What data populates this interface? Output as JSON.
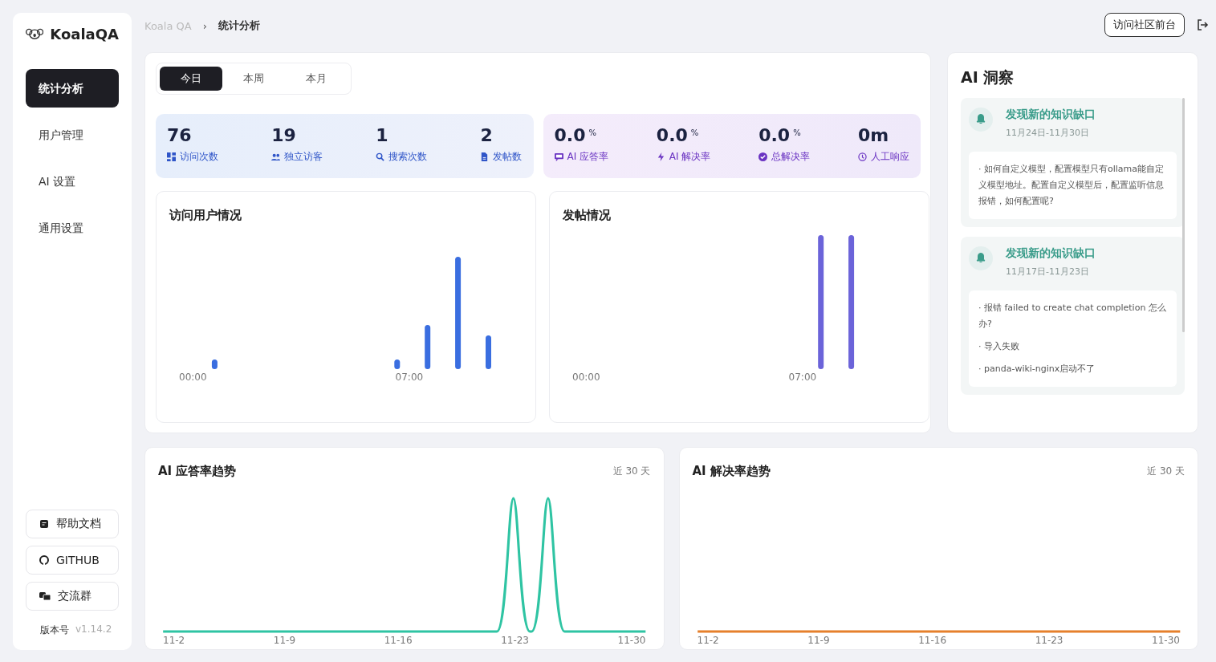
{
  "sidebar": {
    "logo": "KoalaQA",
    "items": [
      {
        "label": "统计分析",
        "selected": true
      },
      {
        "label": "用户管理",
        "selected": false
      },
      {
        "label": "AI 设置",
        "selected": false
      },
      {
        "label": "通用设置",
        "selected": false
      }
    ],
    "links": [
      "帮助文档",
      "GITHUB",
      "交流群"
    ],
    "version_label": "版本号",
    "version": "v1.14.2"
  },
  "breadcrumb": [
    "Koala QA",
    "统计分析"
  ],
  "breadcrumb_separator": "›",
  "top_button": "访问社区前台",
  "tabs": [
    {
      "label": "今日",
      "selected": true
    },
    {
      "label": "本周",
      "selected": false
    },
    {
      "label": "本月",
      "selected": false
    }
  ],
  "stat_groups": [
    {
      "kind": "traffic",
      "stats": [
        {
          "value": "76",
          "label": "访问次数"
        },
        {
          "value": "19",
          "label": "独立访客"
        },
        {
          "value": "1",
          "label": "搜索次数"
        },
        {
          "value": "2",
          "label": "发帖数"
        }
      ]
    },
    {
      "kind": "ai",
      "stats": [
        {
          "value": "0.0",
          "unit": "%",
          "label": "AI 应答率"
        },
        {
          "value": "0.0",
          "unit": "%",
          "label": "AI 解决率"
        },
        {
          "value": "0.0",
          "unit": "%",
          "label": "总解决率"
        },
        {
          "value": "0m",
          "label": "人工响应"
        }
      ]
    }
  ],
  "hour_charts": [
    {
      "title": "访问用户情况",
      "x_labels": [
        "00:00",
        "07:00"
      ]
    },
    {
      "title": "发帖情况",
      "x_labels": [
        "00:00",
        "07:00"
      ]
    }
  ],
  "insights": {
    "title": "AI 洞察",
    "cards": [
      {
        "title": "发现新的知识缺口",
        "date": "11月24日-11月30日",
        "items": [
          "· 如何自定义模型，配置模型只有ollama能自定义模型地址。配置自定义模型后，配置监听信息报错，如何配置呢?"
        ]
      },
      {
        "title": "发现新的知识缺口",
        "date": "11月17日-11月23日",
        "items": [
          "· 报错 failed to create chat completion 怎么办?",
          "· 导入失败",
          "· panda-wiki-nginx启动不了"
        ]
      }
    ]
  },
  "trend_charts": [
    {
      "title": "AI 应答率趋势",
      "range": "近 30 天",
      "x_labels": [
        "11-2",
        "11-9",
        "11-16",
        "11-23",
        "11-30"
      ]
    },
    {
      "title": "AI 解决率趋势",
      "range": "近 30 天",
      "x_labels": [
        "11-2",
        "11-9",
        "11-16",
        "11-23",
        "11-30"
      ]
    }
  ]
}
